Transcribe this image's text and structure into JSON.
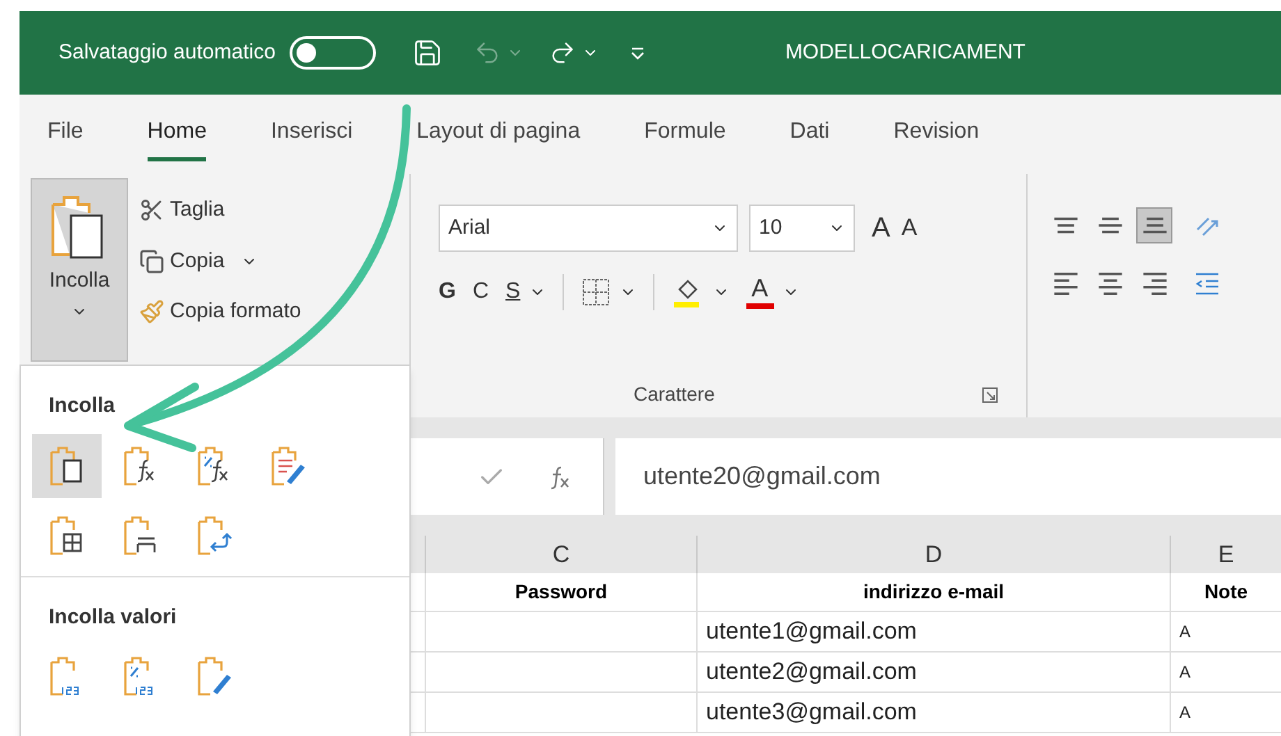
{
  "title_bar": {
    "autosave_label": "Salvataggio automatico",
    "autosave_on": false,
    "title": "MODELLOCARICAMENT"
  },
  "tabs": [
    {
      "label": "File",
      "selected": false
    },
    {
      "label": "Home",
      "selected": true
    },
    {
      "label": "Inserisci",
      "selected": false
    },
    {
      "label": "Layout di pagina",
      "selected": false
    },
    {
      "label": "Formule",
      "selected": false
    },
    {
      "label": "Dati",
      "selected": false
    },
    {
      "label": "Revision",
      "selected": false
    }
  ],
  "clipboard": {
    "paste_label": "Incolla",
    "cut": "Taglia",
    "copy": "Copia",
    "format_painter": "Copia formato"
  },
  "font": {
    "name": "Arial",
    "size": "10",
    "grow": "A",
    "shrink": "A",
    "bold": "G",
    "italic": "C",
    "underline": "S",
    "font_color_label": "A",
    "group_label": "Carattere"
  },
  "alignment": {
    "vertical": [
      {
        "kind": "top",
        "selected": false
      },
      {
        "kind": "middle",
        "selected": false
      },
      {
        "kind": "bottom",
        "selected": true
      }
    ],
    "horizontal": [
      {
        "kind": "left",
        "selected": false
      },
      {
        "kind": "center",
        "selected": false
      },
      {
        "kind": "right",
        "selected": false
      }
    ]
  },
  "paste_menu": {
    "sections": [
      {
        "heading": "Incolla",
        "rows": [
          [
            {
              "kind": "paste",
              "selected": true
            },
            {
              "kind": "formulas",
              "selected": false
            },
            {
              "kind": "formulas-number",
              "selected": false
            },
            {
              "kind": "source-format",
              "selected": false
            }
          ],
          [
            {
              "kind": "no-borders",
              "selected": false
            },
            {
              "kind": "column-widths",
              "selected": false
            },
            {
              "kind": "transpose",
              "selected": false
            }
          ]
        ]
      },
      {
        "heading": "Incolla valori",
        "rows": [
          [
            {
              "kind": "values",
              "selected": false
            },
            {
              "kind": "values-number",
              "selected": false
            },
            {
              "kind": "values-source",
              "selected": false
            }
          ]
        ]
      }
    ]
  },
  "formula_bar": {
    "value": "utente20@gmail.com"
  },
  "sheet": {
    "columns": [
      "C",
      "D",
      "E"
    ],
    "header": [
      "Password",
      "indirizzo e-mail",
      "Note"
    ],
    "rows": [
      {
        "email": "utente1@gmail.com",
        "note": "A"
      },
      {
        "email": "utente2@gmail.com",
        "note": "A"
      },
      {
        "email": "utente3@gmail.com",
        "note": "A"
      }
    ]
  }
}
